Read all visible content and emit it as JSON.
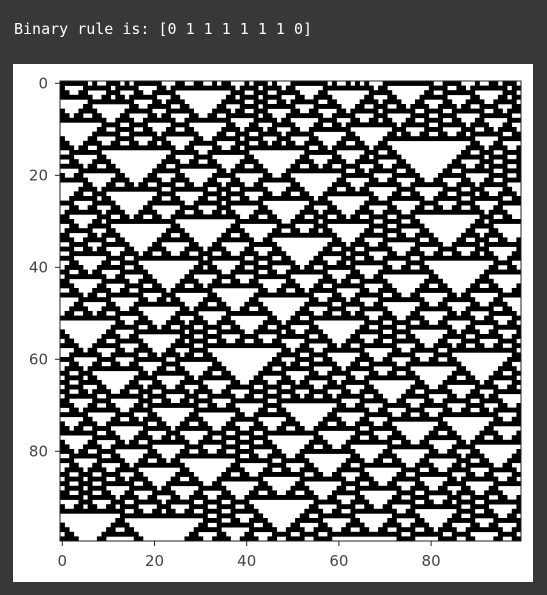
{
  "output": {
    "text": "Binary rule is: [0 1 1 1 1 1 1 0]"
  },
  "chart_data": {
    "type": "heatmap",
    "description_source": "cellular automaton raster plot",
    "rule_binary": [
      0,
      1,
      1,
      1,
      1,
      1,
      1,
      0
    ],
    "cmap": "binary",
    "xlim": [
      0,
      99
    ],
    "ylim": [
      99,
      0
    ],
    "rows": 100,
    "cols": 100,
    "x_ticks": [
      0,
      20,
      40,
      60,
      80
    ],
    "y_ticks": [
      0,
      20,
      40,
      60,
      80
    ],
    "x_tick_labels": [
      "0",
      "20",
      "40",
      "60",
      "80"
    ],
    "y_tick_labels": [
      "0",
      "20",
      "40",
      "60",
      "80"
    ],
    "colors": {
      "on": "#000000",
      "off": "#ffffff",
      "frame": "#222222",
      "background": "#383838"
    }
  }
}
